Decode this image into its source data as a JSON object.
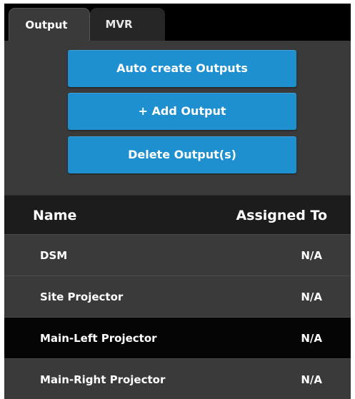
{
  "tabs": {
    "output_label": "Output",
    "mvr_label": "MVR",
    "active": "Output"
  },
  "actions": {
    "auto_create_label": "Auto create Outputs",
    "add_output_label": "+ Add Output",
    "delete_outputs_label": "Delete Output(s)"
  },
  "table": {
    "columns": {
      "name": "Name",
      "assigned_to": "Assigned To"
    },
    "rows": [
      {
        "name": "DSM",
        "assigned_to": "N/A",
        "selected": false
      },
      {
        "name": "Site Projector",
        "assigned_to": "N/A",
        "selected": false
      },
      {
        "name": "Main-Left Projector",
        "assigned_to": "N/A",
        "selected": true
      },
      {
        "name": "Main-Right Projector",
        "assigned_to": "N/A",
        "selected": false
      }
    ]
  },
  "colors": {
    "accent_button": "#1e8fcf",
    "panel_background": "#3a3a3a",
    "selected_row": "#050505",
    "header_background": "#1c1c1c"
  }
}
